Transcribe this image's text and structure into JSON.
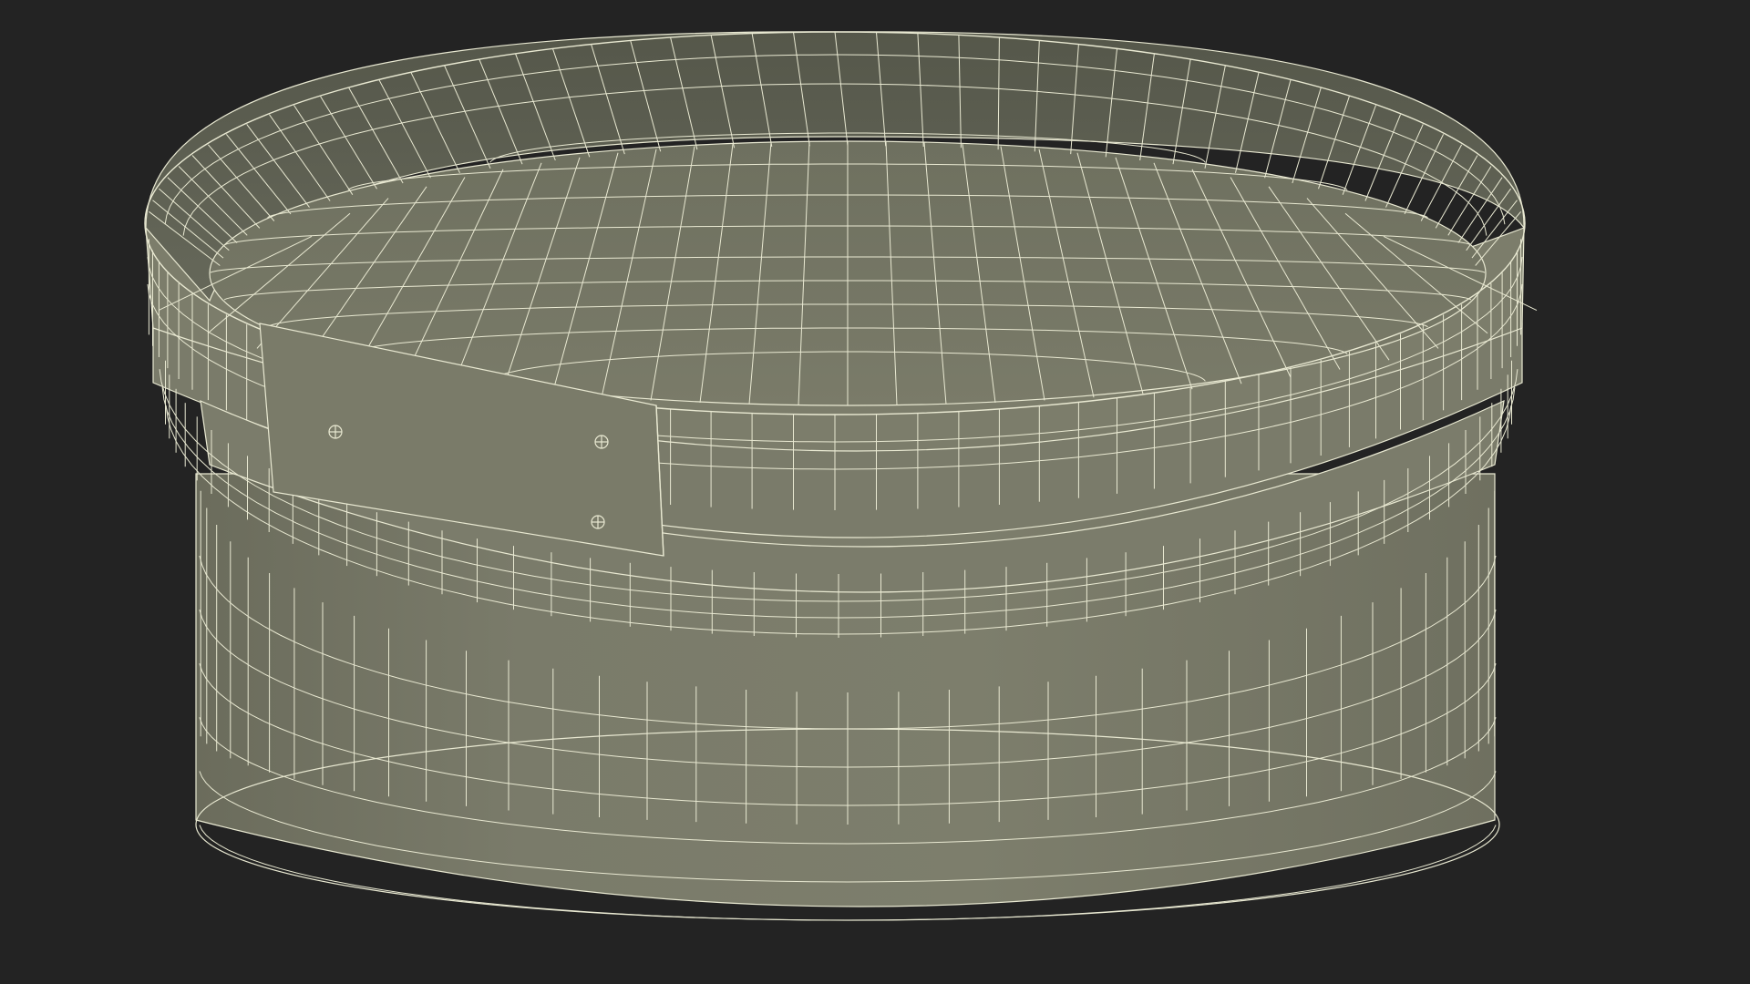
{
  "scene": {
    "background_color": "#232323",
    "subject": "wireframe-round-box",
    "mesh_fill_outer": "#7b7c6b",
    "mesh_fill_inner": "#6e705f",
    "mesh_fill_inner_wall": "#5f6152",
    "mesh_fill_floor": "#777867",
    "wire_color": "#e9e9d2",
    "shadow_color": "#4e4f43"
  }
}
